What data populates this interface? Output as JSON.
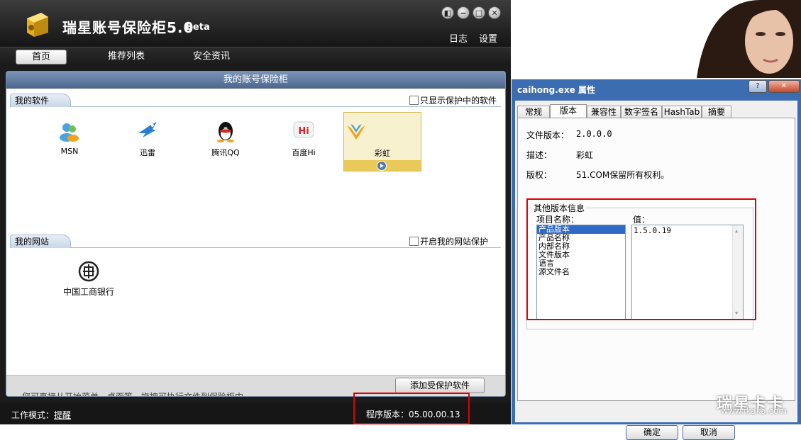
{
  "app": {
    "title": "瑞星账号保险柜5.0",
    "beta": "Beta",
    "top_links": {
      "log": "日志",
      "settings": "设置"
    },
    "nav": [
      {
        "label": "首页",
        "active": true
      },
      {
        "label": "推荐列表",
        "active": false
      },
      {
        "label": "安全资讯",
        "active": false
      }
    ],
    "panel_title": "我的账号保险柜",
    "software_section": {
      "tab": "我的软件",
      "checkbox_label": "只显示保护中的软件",
      "items": [
        {
          "label": "MSN",
          "icon": "msn-icon"
        },
        {
          "label": "迅雷",
          "icon": "xunlei-icon"
        },
        {
          "label": "腾讯QQ",
          "icon": "qq-icon"
        },
        {
          "label": "百度Hi",
          "icon": "baidu-hi-icon"
        },
        {
          "label": "彩虹",
          "icon": "caihong-icon",
          "selected": true
        }
      ]
    },
    "website_section": {
      "tab": "我的网站",
      "checkbox_label": "开启我的网站保护",
      "items": [
        {
          "label": "中国工商银行",
          "icon": "icbc-icon"
        }
      ]
    },
    "add_button": "添加受保护软件",
    "clipped_hint": "您可直接从开始菜单、桌面等，拖拽可执行文件到保险柜中",
    "status": {
      "mode_label": "工作模式：",
      "mode_value": "提醒",
      "version": "程序版本：05.00.00.13"
    }
  },
  "dialog": {
    "title": "caihong.exe 属性",
    "ctrl_help": "?",
    "ctrl_close": "✕",
    "tabs": [
      {
        "label": "常规",
        "active": false
      },
      {
        "label": "版本",
        "active": true
      },
      {
        "label": "兼容性",
        "active": false
      },
      {
        "label": "数字签名",
        "active": false
      },
      {
        "label": "HashTab",
        "active": false
      },
      {
        "label": "摘要",
        "active": false
      }
    ],
    "file_version_label": "文件版本：",
    "file_version": "2.0.0.0",
    "description_label": "描述：",
    "description": "彩虹",
    "copyright_label": "版权：",
    "copyright": "51.COM保留所有权利。",
    "other_info_caption": "其他版本信息",
    "item_name_label": "项目名称：",
    "value_label": "值：",
    "items": [
      "产品版本",
      "产品名称",
      "内部名称",
      "文件版本",
      "语言",
      "源文件名"
    ],
    "selected_index": 0,
    "value": "1.5.0.19",
    "ok": "确定",
    "cancel": "取消"
  },
  "watermark": {
    "text": "瑞星卡卡",
    "url": "www.ikaka.com"
  }
}
